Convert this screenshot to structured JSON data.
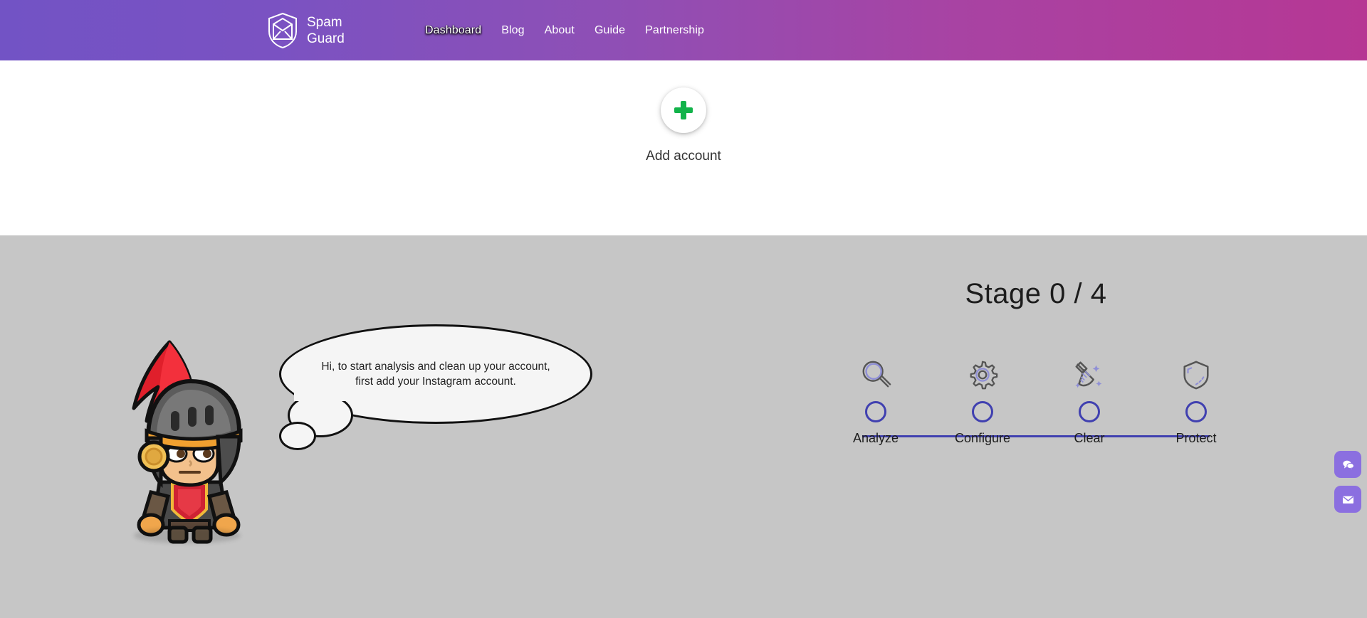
{
  "header": {
    "brand": {
      "name_line1": "Spam",
      "name_line2": "Guard",
      "logo_icon": "shield-envelope-icon"
    },
    "gradient_start": "#7253c5",
    "gradient_end": "#b63794",
    "nav": [
      {
        "label": "Dashboard",
        "active": true
      },
      {
        "label": "Blog",
        "active": false
      },
      {
        "label": "About",
        "active": false
      },
      {
        "label": "Guide",
        "active": false
      },
      {
        "label": "Partnership",
        "active": false
      }
    ]
  },
  "accounts": {
    "add_label": "Add account",
    "plus_icon": "plus-icon",
    "plus_color": "#12b34a"
  },
  "assistant": {
    "character": "knight-mascot",
    "message": "Hi, to start analysis and clean up your account, first add your Instagram account."
  },
  "stage": {
    "title": "Stage 0 / 4",
    "current": 0,
    "total": 4,
    "line_color": "#4040b0",
    "steps": [
      {
        "label": "Analyze",
        "icon": "magnifier-icon",
        "done": false
      },
      {
        "label": "Configure",
        "icon": "gear-icon",
        "done": false
      },
      {
        "label": "Clear",
        "icon": "broom-icon",
        "done": false
      },
      {
        "label": "Protect",
        "icon": "shield-icon",
        "done": false
      }
    ]
  },
  "floating_actions": [
    {
      "icon": "chat-icon",
      "color": "#8b6fe0"
    },
    {
      "icon": "envelope-icon",
      "color": "#8b6fe0"
    }
  ]
}
